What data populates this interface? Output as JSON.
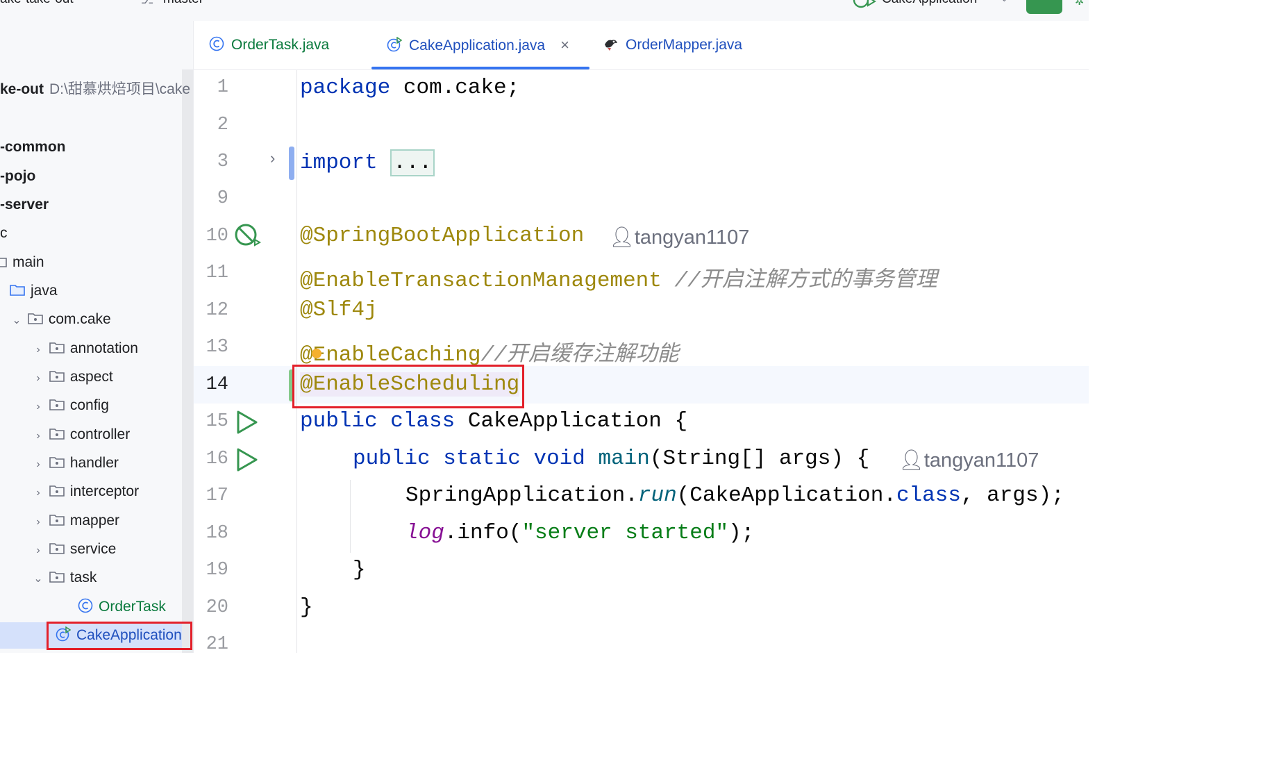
{
  "topbar": {
    "project": "ake-take-out",
    "branch": "master",
    "run_config": "CakeApplication"
  },
  "project_tree": {
    "root": {
      "name": "ke-out",
      "path": "D:\\甜慕烘焙项目\\cake"
    },
    "items": [
      {
        "label": "-common"
      },
      {
        "label": "-pojo"
      },
      {
        "label": "-server"
      },
      {
        "label": "c"
      },
      {
        "label": "main"
      },
      {
        "label": "java"
      },
      {
        "label": "com.cake"
      },
      {
        "label": "annotation"
      },
      {
        "label": "aspect"
      },
      {
        "label": "config"
      },
      {
        "label": "controller"
      },
      {
        "label": "handler"
      },
      {
        "label": "interceptor"
      },
      {
        "label": "mapper"
      },
      {
        "label": "service"
      },
      {
        "label": "task"
      },
      {
        "label": "OrderTask"
      },
      {
        "label": "CakeApplication"
      }
    ]
  },
  "tabs": [
    {
      "label": "OrderTask.java"
    },
    {
      "label": "CakeApplication.java",
      "close": "×"
    },
    {
      "label": "OrderMapper.java"
    }
  ],
  "editor": {
    "line_numbers": [
      "1",
      "2",
      "3",
      "9",
      "10",
      "11",
      "12",
      "13",
      "14",
      "15",
      "16",
      "17",
      "18",
      "19",
      "20",
      "21"
    ],
    "code": {
      "l1_kw": "package",
      "l1_rest": " com.cake;",
      "l3_kw": "import",
      "l3_dots": "...",
      "l10_ann": "@SpringBootApplication",
      "l10_author": "tangyan1107",
      "l11_ann": "@EnableTransactionManagement",
      "l11_cmt": " //开启注解方式的事务管理",
      "l12_ann": "@Slf4j",
      "l13_ann_a": "@",
      "l13_ann_b": "EnableCaching",
      "l13_cmt": "//开启缓存注解功能",
      "l14_ann": "@EnableScheduling",
      "l15_kw1": "public",
      "l15_kw2": "class",
      "l15_rest": " CakeApplication {",
      "l16_kw1": "public",
      "l16_kw2": "static",
      "l16_kw3": "void",
      "l16_meth": "main",
      "l16_rest": "(String[] args) {",
      "l16_author": "tangyan1107",
      "l17_a": "SpringApplication.",
      "l17_run": "run",
      "l17_b": "(CakeApplication.",
      "l17_kw": "class",
      "l17_c": ", args);",
      "l18_fld": "log",
      "l18_a": ".info(",
      "l18_str": "\"server started\"",
      "l18_b": ");",
      "l19": "}",
      "l20": "}"
    }
  },
  "colors": {
    "keyword": "#0033b3",
    "annotation": "#9e880d",
    "comment": "#8c8c8c",
    "string": "#067d17",
    "highlight_box": "#e3202a",
    "tab_underline": "#3574f0",
    "run_green": "#369650"
  }
}
